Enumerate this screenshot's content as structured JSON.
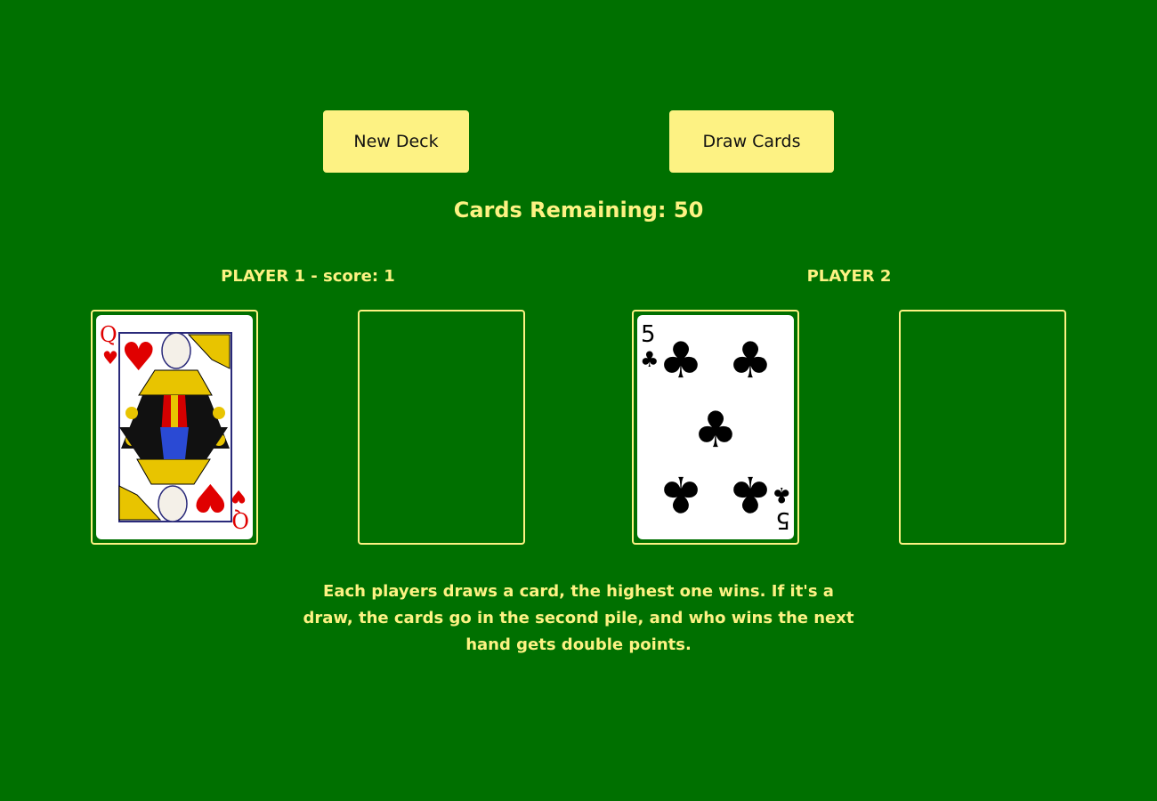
{
  "buttons": {
    "new_deck": "New Deck",
    "draw_cards": "Draw Cards"
  },
  "cards_remaining": "Cards Remaining: 50",
  "players": [
    {
      "title": "PLAYER 1 - score: 1",
      "card": {
        "rank": "Q",
        "suit": "hearts"
      }
    },
    {
      "title": "PLAYER 2",
      "card": {
        "rank": "5",
        "suit": "clubs"
      }
    }
  ],
  "rules": "Each players draws a card, the highest one wins. If it's a draw, the cards go in the second pile, and who wins the next hand gets double points.",
  "colors": {
    "table": "#007000",
    "accent": "#fdf283",
    "hearts": "#e00000",
    "clubs": "#000000"
  }
}
